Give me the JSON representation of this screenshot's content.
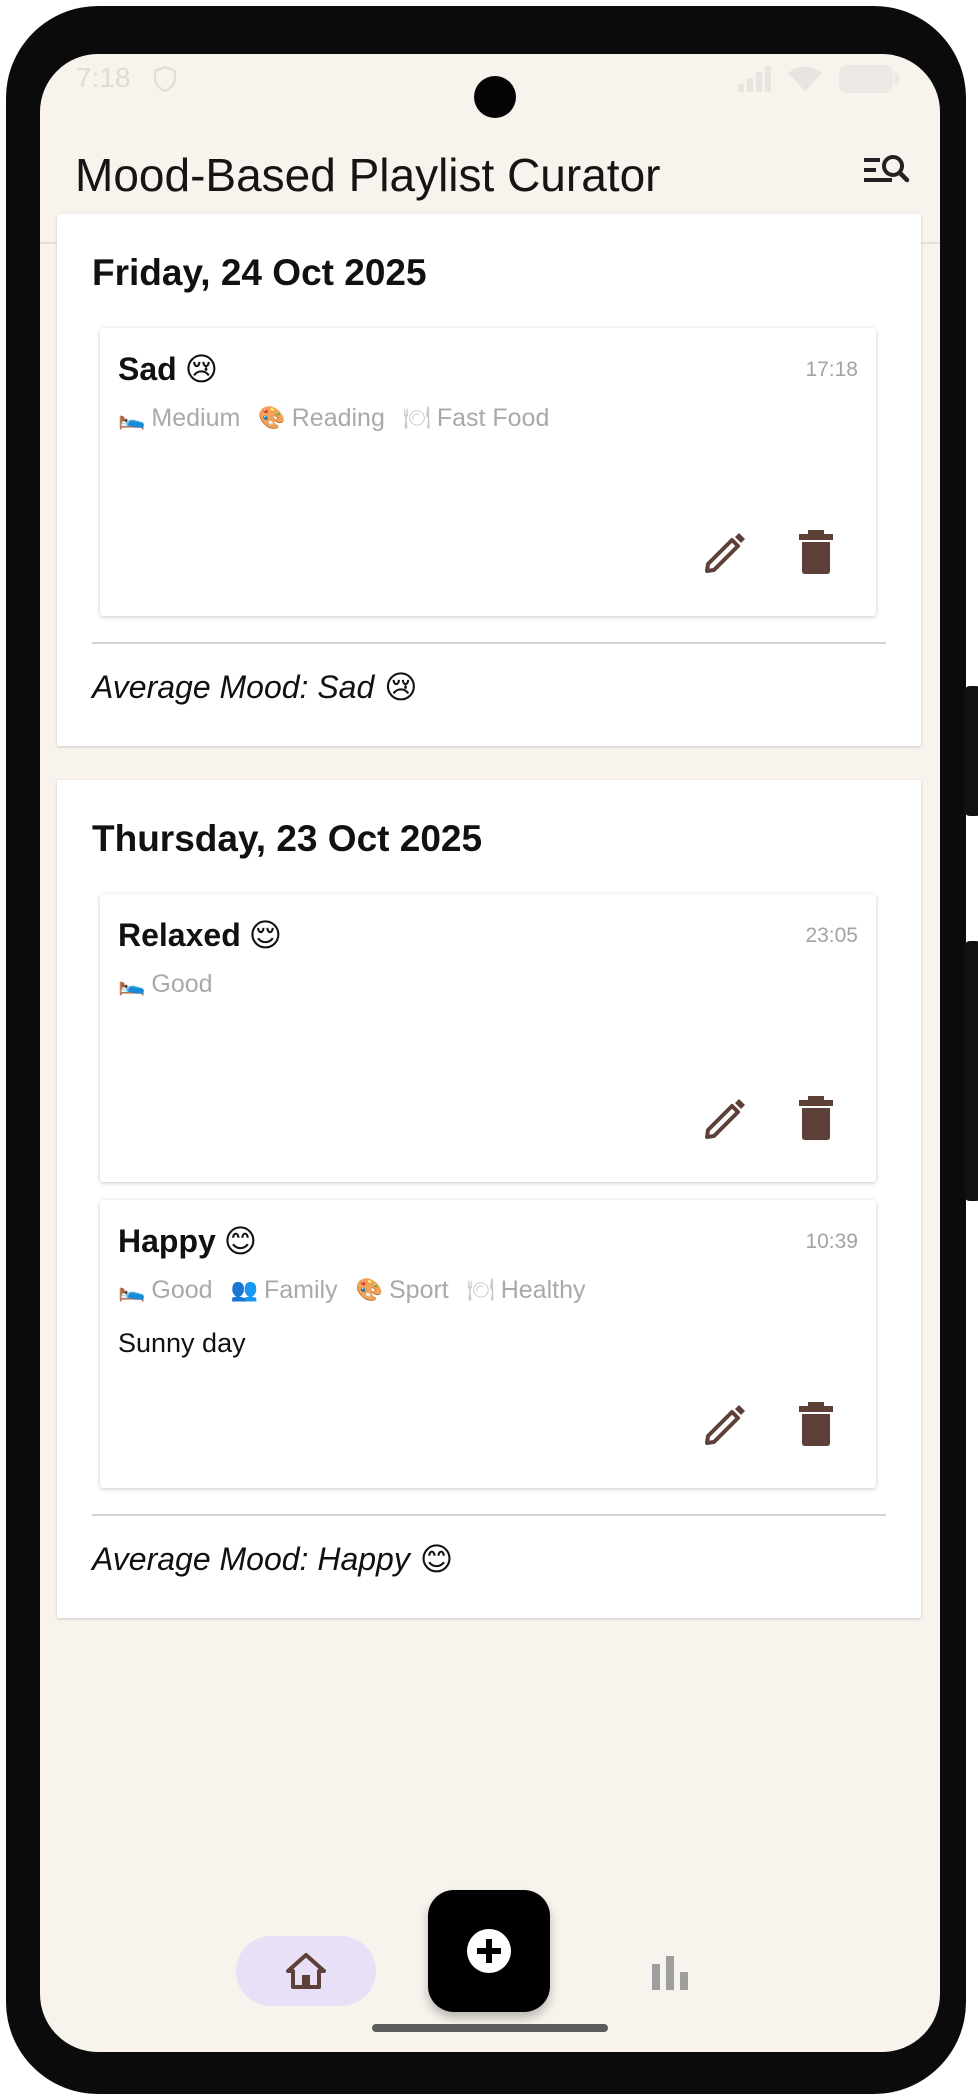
{
  "status_bar": {
    "time": "7:18"
  },
  "app_bar": {
    "title": "Mood-Based Playlist Curator",
    "search_icon": "manage-search-icon"
  },
  "days": [
    {
      "title": "Friday, 24 Oct 2025",
      "entries": [
        {
          "mood": "Sad",
          "emoji": "😢",
          "time": "17:18",
          "tags": [
            {
              "icon": "🛌",
              "label": "Medium"
            },
            {
              "icon": "🎨",
              "label": "Reading"
            },
            {
              "icon": "🍽",
              "label": "Fast Food"
            }
          ],
          "note": ""
        }
      ],
      "average": {
        "label": "Average Mood: Sad",
        "emoji": "😢"
      }
    },
    {
      "title": "Thursday, 23 Oct 2025",
      "entries": [
        {
          "mood": "Relaxed",
          "emoji": "😌",
          "time": "23:05",
          "tags": [
            {
              "icon": "🛌",
              "label": "Good"
            }
          ],
          "note": ""
        },
        {
          "mood": "Happy",
          "emoji": "😊",
          "time": "10:39",
          "tags": [
            {
              "icon": "🛌",
              "label": "Good"
            },
            {
              "icon": "👥",
              "label": "Family"
            },
            {
              "icon": "🎨",
              "label": "Sport"
            },
            {
              "icon": "🍽",
              "label": "Healthy"
            }
          ],
          "note": "Sunny day"
        }
      ],
      "average": {
        "label": "Average Mood: Happy",
        "emoji": "😊"
      }
    }
  ],
  "bottom_nav": {
    "items": [
      "home-icon",
      "add-icon",
      "bar-chart-icon"
    ],
    "active": "home"
  },
  "colors": {
    "background": "#f8f3ed",
    "action_icon": "#5d4037",
    "nav_active_pill": "#e8e0f6",
    "fab": "#000000"
  }
}
